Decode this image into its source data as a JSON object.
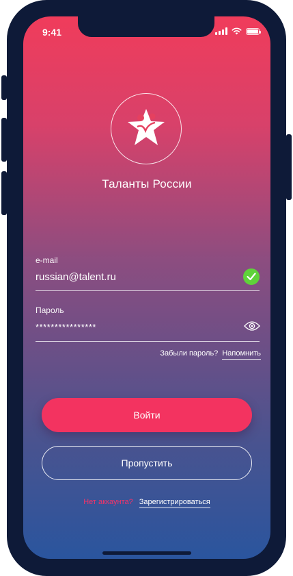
{
  "status_bar": {
    "time": "9:41",
    "icons": [
      "signal-icon",
      "wifi-icon",
      "battery-icon"
    ]
  },
  "app": {
    "title": "Таланты России",
    "logo_icon": "star-people-logo-icon"
  },
  "form": {
    "email_label": "e-mail",
    "email_value": "russian@talent.ru",
    "email_valid_icon": "check-icon",
    "password_label": "Пароль",
    "password_value": "****************",
    "password_toggle_icon": "eye-icon",
    "forgot_text": "Забыли пароль?",
    "forgot_link": "Напомнить"
  },
  "actions": {
    "login_label": "Войти",
    "skip_label": "Пропустить",
    "no_account_text": "Нет аккаунта?",
    "register_link": "Зарегистрироваться"
  },
  "colors": {
    "gradient_top": "#f03c5b",
    "gradient_bottom": "#2a559e",
    "accent": "#f33360",
    "valid": "#5fd23a",
    "frame": "#0e1a38"
  }
}
